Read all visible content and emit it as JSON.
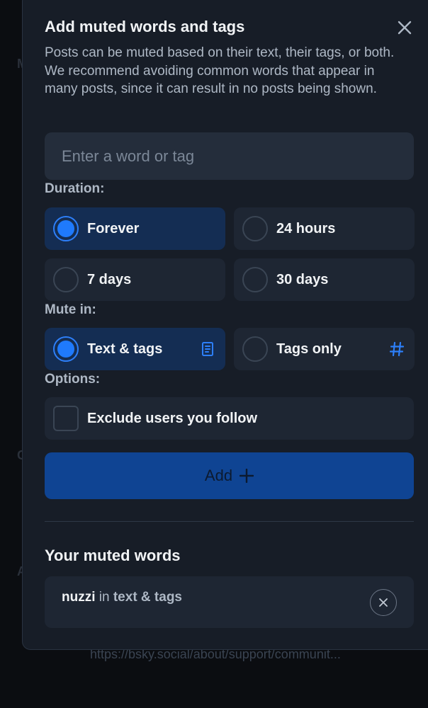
{
  "background": {
    "letters": [
      "M",
      "C",
      "A"
    ],
    "url": "https://bsky.social/about/support/communit..."
  },
  "modal": {
    "title": "Add muted words and tags",
    "close_icon": "close-icon",
    "description": "Posts can be muted based on their text, their tags, or both. We recommend avoiding common words that appear in many posts, since it can result in no posts being shown.",
    "input": {
      "placeholder": "Enter a word or tag",
      "value": ""
    },
    "duration": {
      "label": "Duration:",
      "selected": "Forever",
      "options": [
        "Forever",
        "24 hours",
        "7 days",
        "30 days"
      ]
    },
    "mute_in": {
      "label": "Mute in:",
      "selected": "Text & tags",
      "options": [
        {
          "label": "Text & tags",
          "icon": "document-icon"
        },
        {
          "label": "Tags only",
          "icon": "hashtag-icon"
        }
      ]
    },
    "options": {
      "label": "Options:",
      "exclude_label": "Exclude users you follow",
      "exclude_checked": false
    },
    "add_button": {
      "label": "Add",
      "icon": "plus-icon"
    },
    "muted_words": {
      "heading": "Your muted words",
      "items": [
        {
          "word": "nuzzi",
          "in": "in",
          "scope": "text & tags",
          "remove_icon": "close-circle-icon"
        }
      ]
    }
  },
  "colors": {
    "accent": "#1f7afc",
    "selected_bg": "#142d53",
    "button_bg": "#0f4493",
    "modal_bg": "#171d27"
  }
}
